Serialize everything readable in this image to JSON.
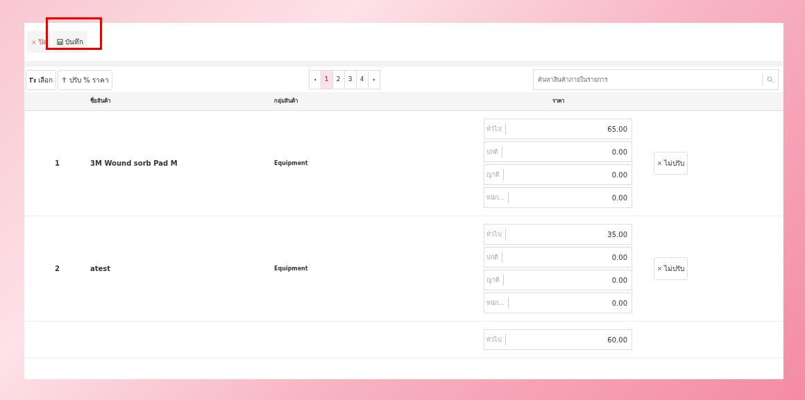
{
  "toolbar": {
    "close_button": "ปิด",
    "save_button": "บันทึก",
    "save_highlighted": true
  },
  "actions": {
    "select_button": "เลือก",
    "adjust_button": "ปรับ % ราคา"
  },
  "pagination": {
    "pages": [
      {
        "label": "1",
        "selected": true
      },
      {
        "label": "2",
        "selected": false
      },
      {
        "label": "3",
        "selected": false
      },
      {
        "label": "4",
        "selected": false
      }
    ]
  },
  "search": {
    "placeholder": "ค้นหาสินค้าภายในรายการ"
  },
  "table": {
    "columns": [
      "ชื่อสินค้า",
      "กลุ่มสินค้า",
      "ราคา"
    ],
    "rows": [
      {
        "number": "1",
        "name": "3M Wound sorb Pad M",
        "group": "Equipment",
        "prices": [
          {
            "label": "ทั่วไป",
            "value": "65.00"
          },
          {
            "label": "ปกติ",
            "value": "0.00"
          },
          {
            "label": "ญาติ",
            "value": "0.00"
          },
          {
            "label": "หนัก...",
            "value": "0.00"
          }
        ],
        "action": "ไม่ปรับ"
      },
      {
        "number": "2",
        "name": "atest",
        "group": "Equipment",
        "prices": [
          {
            "label": "ทั่วไป",
            "value": "35.00"
          },
          {
            "label": "ปกติ",
            "value": "0.00"
          },
          {
            "label": "ญาติ",
            "value": "0.00"
          },
          {
            "label": "หนัก...",
            "value": "0.00"
          }
        ],
        "action": "ไม่ปรับ"
      },
      {
        "prices": [
          {
            "label": "ทั่วไป",
            "value": "60.00"
          }
        ]
      }
    ]
  }
}
